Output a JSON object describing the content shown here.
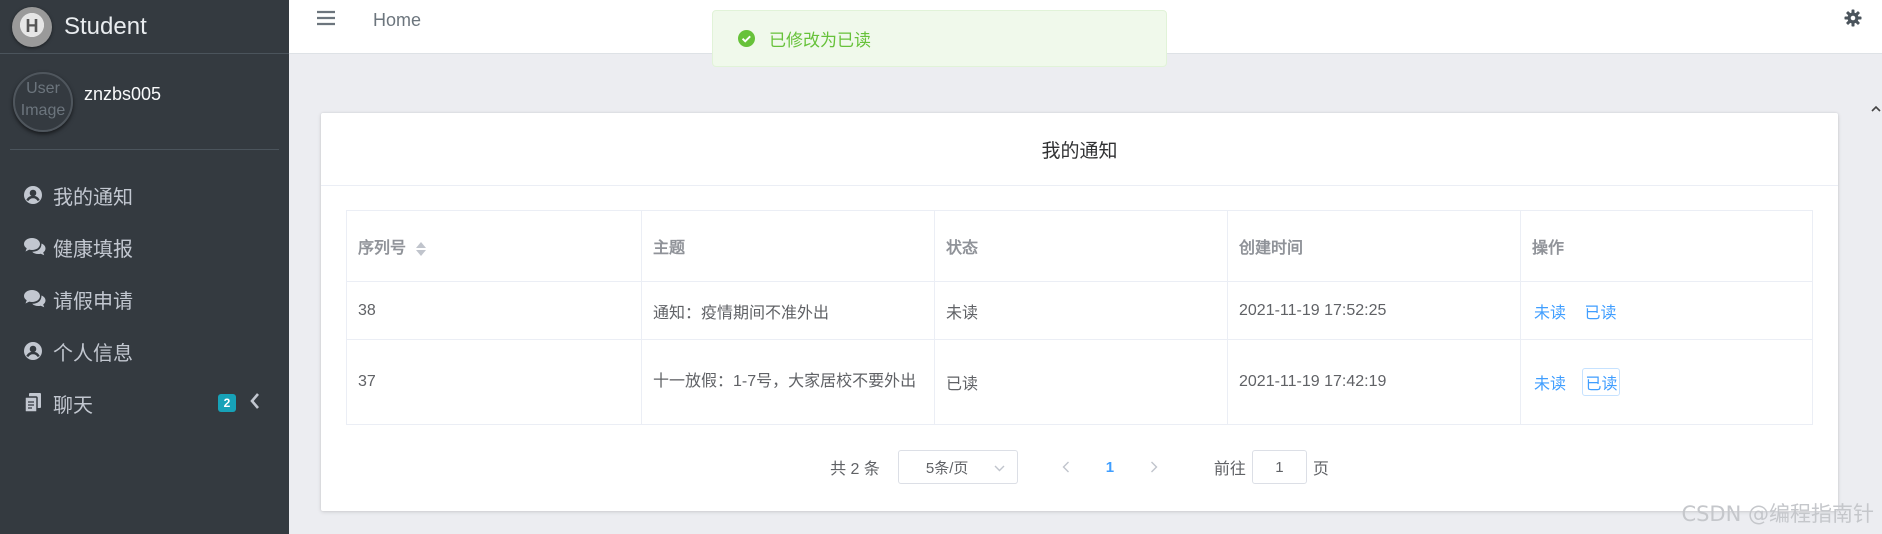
{
  "sidebar": {
    "brand": "Student",
    "logo_letter": "H",
    "user_image_alt": "User Image",
    "username": "znzbs005",
    "items": [
      {
        "label": "我的通知",
        "icon": "user-circle-icon"
      },
      {
        "label": "健康填报",
        "icon": "comments-icon"
      },
      {
        "label": "请假申请",
        "icon": "comments-icon"
      },
      {
        "label": "个人信息",
        "icon": "user-circle-icon"
      },
      {
        "label": "聊天",
        "icon": "copy-icon",
        "badge": "2"
      }
    ]
  },
  "topbar": {
    "home": "Home"
  },
  "toast": {
    "message": "已修改为已读",
    "color": "#67c23a"
  },
  "card": {
    "title": "我的通知",
    "columns": [
      "序列号",
      "主题",
      "状态",
      "创建时间",
      "操作"
    ],
    "rows": [
      {
        "id": "38",
        "subject": "通知：疫情期间不准外出",
        "status": "未读",
        "created": "2021-11-19 17:52:25",
        "actions": [
          "未读",
          "已读"
        ]
      },
      {
        "id": "37",
        "subject": "十一放假：1-7号，大家居校不要外出",
        "status": "已读",
        "created": "2021-11-19 17:42:19",
        "actions": [
          "未读",
          "已读"
        ]
      }
    ]
  },
  "pagination": {
    "total": "共 2 条",
    "page_size": "5条/页",
    "current_page": "1",
    "goto_label": "前往",
    "goto_value": "1",
    "goto_suffix": "页"
  },
  "watermark": "CSDN @编程指南针",
  "colors": {
    "sidebar_bg": "#343a40",
    "accent": "#409eff",
    "badge": "#17a2b8"
  }
}
